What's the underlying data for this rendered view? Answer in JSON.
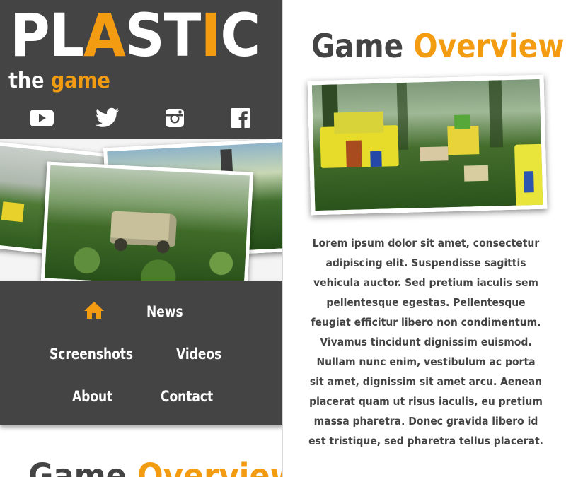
{
  "brand": {
    "logo_part1": "PL",
    "logo_accent1": "A",
    "logo_part2": "ST",
    "logo_accent2": "I",
    "logo_part3": "C",
    "tagline_part1": "the ",
    "tagline_accent": "game"
  },
  "socials": [
    {
      "icon": "youtube-icon"
    },
    {
      "icon": "twitter-icon"
    },
    {
      "icon": "instagram-icon"
    },
    {
      "icon": "facebook-icon"
    }
  ],
  "nav": {
    "home_icon": "home-icon",
    "items": [
      {
        "label": "News"
      },
      {
        "label": "Screenshots"
      },
      {
        "label": "Videos"
      },
      {
        "label": "About"
      },
      {
        "label": "Contact"
      }
    ]
  },
  "overview": {
    "title_main": "Game ",
    "title_accent": "Overview",
    "description": "Lorem ipsum dolor sit amet, consectetur adipiscing elit. Suspendisse sagittis vehicula auctor. Sed pretium iaculis sem pellentesque egestas. Pellentesque feugiat efficitur libero non condimentum. Vivamus tincidunt dignissim euismod. Nullam nunc enim, vestibulum ac porta sit amet, dignissim sit amet arcu. Aenean placerat quam ut risus iaculis, eu pretium massa pharetra. Donec gravida libero id est tristique, sed pharetra tellus placerat."
  },
  "colors": {
    "accent": "#f39c12",
    "dark": "#444444",
    "light": "#ffffff"
  }
}
